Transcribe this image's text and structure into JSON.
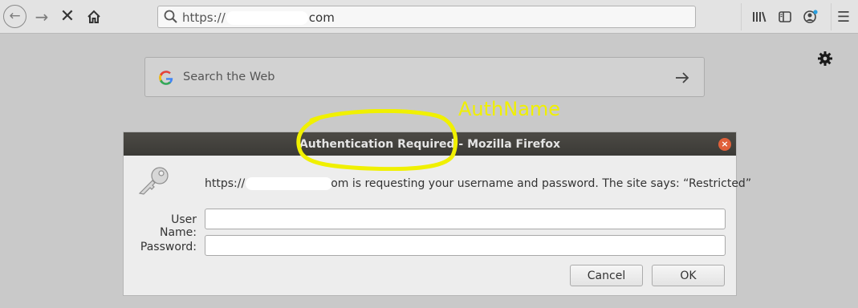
{
  "browser": {
    "url_prefix": "https://",
    "url_suffix": "com",
    "nav": {
      "back_icon": "arrow-left-icon",
      "forward_icon": "arrow-right-icon",
      "stop_icon": "close-icon",
      "home_icon": "home-icon"
    }
  },
  "page": {
    "search_placeholder": "Search the Web"
  },
  "annotation": {
    "label": "AuthName",
    "color": "#f0f000"
  },
  "dialog": {
    "title": "Authentication Required - Mozilla Firefox",
    "message_prefix": "https://",
    "message_suffix": "om is requesting your username and password. The site says: “Restricted”",
    "username_label": "User Name:",
    "password_label": "Password:",
    "username_value": "",
    "password_value": "",
    "cancel_label": "Cancel",
    "ok_label": "OK"
  }
}
